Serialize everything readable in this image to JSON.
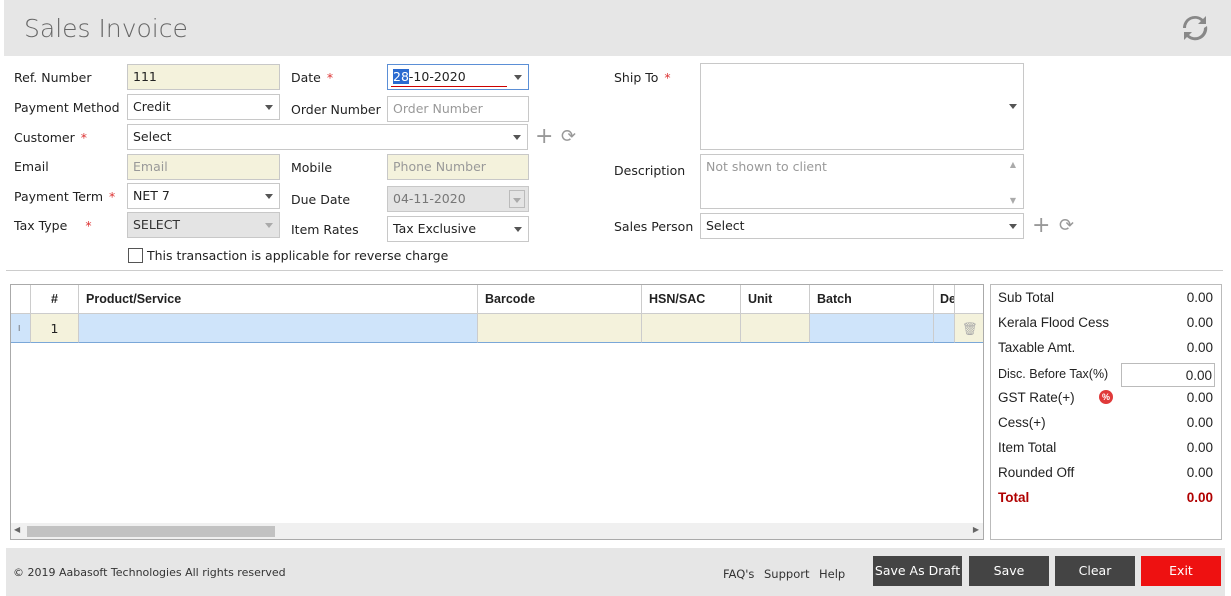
{
  "header": {
    "title": "Sales Invoice",
    "refresh_icon": "refresh-icon"
  },
  "form": {
    "ref_label": "Ref. Number",
    "ref_value": "111",
    "pm_label": "Payment Method",
    "pm_value": "Credit",
    "customer_label": "Customer",
    "customer_value": "Select",
    "email_label": "Email",
    "email_placeholder": "Email",
    "term_label": "Payment Term",
    "term_value": "NET 7",
    "tax_label": "Tax Type",
    "tax_value": "SELECT",
    "date_label": "Date",
    "date_sel": "28",
    "date_rest": "-10-2020",
    "order_label": "Order Number",
    "order_placeholder": "Order Number",
    "mobile_label": "Mobile",
    "mobile_placeholder": "Phone Number",
    "due_label": "Due Date",
    "due_value": "04-11-2020",
    "rates_label": "Item Rates",
    "rates_value": "Tax Exclusive",
    "reverse_label": "This transaction is applicable for reverse charge",
    "ship_label": "Ship To",
    "desc_label": "Description",
    "desc_placeholder": "Not shown to client",
    "sales_label": "Sales Person",
    "sales_value": "Select",
    "required": "*"
  },
  "grid": {
    "columns": [
      "#",
      "Product/Service",
      "Barcode",
      "HSN/SAC",
      "Unit",
      "Batch",
      "De"
    ],
    "rows": [
      {
        "num": "1"
      }
    ]
  },
  "totals": {
    "sub_total": {
      "label": "Sub Total",
      "value": "0.00"
    },
    "flood_cess": {
      "label": "Kerala Flood Cess",
      "value": "0.00"
    },
    "taxable": {
      "label": "Taxable Amt.",
      "value": "0.00"
    },
    "disc": {
      "label": "Disc. Before Tax(%)",
      "value": "0.00"
    },
    "gst": {
      "label": "GST Rate(+)",
      "value": "0.00",
      "badge": "%"
    },
    "cess": {
      "label": "Cess(+)",
      "value": "0.00"
    },
    "item_total": {
      "label": "Item Total",
      "value": "0.00"
    },
    "rounded": {
      "label": "Rounded Off",
      "value": "0.00"
    },
    "total": {
      "label": "Total",
      "value": "0.00"
    }
  },
  "footer": {
    "copyright": "© 2019 Aabasoft Technologies All rights reserved",
    "faq": "FAQ's",
    "support": "Support",
    "help": "Help",
    "draft": "Save As Draft",
    "save": "Save",
    "clear": "Clear",
    "exit": "Exit"
  },
  "colors": {
    "exit": "#ee1111",
    "total": "#b00000",
    "buttons": "#444444"
  }
}
